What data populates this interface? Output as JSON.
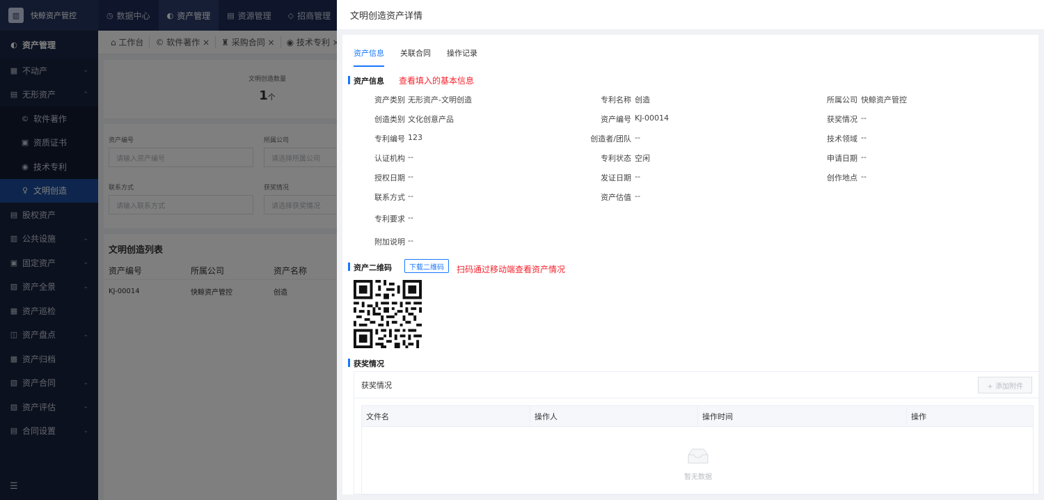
{
  "brand": {
    "logo": "logo-icon",
    "name": "快鲸资产管控"
  },
  "topnav": [
    {
      "icon": "◷",
      "label": "数据中心",
      "active": false
    },
    {
      "icon": "◐",
      "label": "资产管理",
      "active": true
    },
    {
      "icon": "▤",
      "label": "资源管理",
      "active": false
    },
    {
      "icon": "◇",
      "label": "招商管理",
      "active": false
    }
  ],
  "sidebar": {
    "header": "资产管理",
    "items": [
      {
        "label": "不动产",
        "icon": "▦",
        "chev": "⌄"
      },
      {
        "label": "无形资产",
        "icon": "▤",
        "chev": "⌃"
      },
      {
        "label": "软件著作",
        "icon": "©",
        "sub": true
      },
      {
        "label": "资质证书",
        "icon": "▣",
        "sub": true
      },
      {
        "label": "技术专利",
        "icon": "◉",
        "sub": true
      },
      {
        "label": "文明创造",
        "icon": "♀",
        "sub": true,
        "active": true
      },
      {
        "label": "股权资产",
        "icon": "▤",
        "chev": ""
      },
      {
        "label": "公共设施",
        "icon": "▥",
        "chev": "⌄"
      },
      {
        "label": "固定资产",
        "icon": "▣",
        "chev": "⌄"
      },
      {
        "label": "资产全景",
        "icon": "▨",
        "chev": "⌄"
      },
      {
        "label": "资产巡检",
        "icon": "▦",
        "chev": ""
      },
      {
        "label": "资产盘点",
        "icon": "◫",
        "chev": "⌄"
      },
      {
        "label": "资产归档",
        "icon": "▩",
        "chev": ""
      },
      {
        "label": "资产合同",
        "icon": "▧",
        "chev": "⌄"
      },
      {
        "label": "资产评估",
        "icon": "▨",
        "chev": "⌄"
      },
      {
        "label": "合同设置",
        "icon": "▤",
        "chev": "⌄"
      }
    ],
    "collapse_icon": "☰"
  },
  "tabs": [
    "⌂ 工作台",
    "© 软件著作 ×",
    "♜ 采购合同 ×",
    "◉ 技术专利 ×"
  ],
  "stat": {
    "label": "文明创造数量",
    "value": "1",
    "unit": "个"
  },
  "filters": {
    "asset_no_label": "资产编号",
    "asset_no_placeholder": "请输入资产编号",
    "company_label": "所属公司",
    "company_placeholder": "请选择所属公司",
    "contact_label": "联系方式",
    "contact_placeholder": "请输入联系方式",
    "award_label": "获奖情况",
    "award_placeholder": "请选择获奖情况"
  },
  "list": {
    "title": "文明创造列表",
    "columns": [
      "资产编号",
      "所属公司",
      "资产名称"
    ],
    "rows": [
      [
        "KJ-00014",
        "快鲸资产管控",
        "创造"
      ]
    ]
  },
  "drawer": {
    "title": "文明创造资产详情",
    "tabs": [
      "资产信息",
      "关联合同",
      "操作记录"
    ],
    "section_info": "资产信息",
    "note_info": "查看填入的基本信息",
    "fields_col1": [
      {
        "label": "资产类别",
        "value": "无形资产-文明创造"
      },
      {
        "label": "创造类别",
        "value": "文化创意产品"
      },
      {
        "label": "专利编号",
        "value": "123"
      },
      {
        "label": "认证机构",
        "value": "--"
      },
      {
        "label": "授权日期",
        "value": "--"
      },
      {
        "label": "联系方式",
        "value": "--"
      },
      {
        "label": "专利要求",
        "value": "--"
      },
      {
        "label": "附加说明",
        "value": "--"
      }
    ],
    "fields_col2": [
      {
        "label": "专利名称",
        "value": "创造"
      },
      {
        "label": "资产编号",
        "value": "KJ-00014"
      },
      {
        "label": "创造者/团队",
        "value": "--"
      },
      {
        "label": "专利状态",
        "value": "空闲"
      },
      {
        "label": "发证日期",
        "value": "--"
      },
      {
        "label": "资产估值",
        "value": "--"
      }
    ],
    "fields_col3": [
      {
        "label": "所属公司",
        "value": "快鲸资产管控"
      },
      {
        "label": "获奖情况",
        "value": "--"
      },
      {
        "label": "技术领域",
        "value": "--"
      },
      {
        "label": "申请日期",
        "value": "--"
      },
      {
        "label": "创作地点",
        "value": "--"
      }
    ],
    "section_qr": "资产二维码",
    "download_qr": "下载二维码",
    "note_qr": "扫码通过移动端查看资产情况",
    "section_award": "获奖情况",
    "award_box_title": "获奖情况",
    "add_attachment": "+ 添加附件",
    "table_columns": [
      "文件名",
      "操作人",
      "操作时间",
      "操作"
    ],
    "empty_text": "暂无数据"
  },
  "colors": {
    "primary": "#1677ff",
    "note_red": "#f5222d",
    "sidebar_bg": "#18223e",
    "active_sub": "#1d4c9a"
  }
}
